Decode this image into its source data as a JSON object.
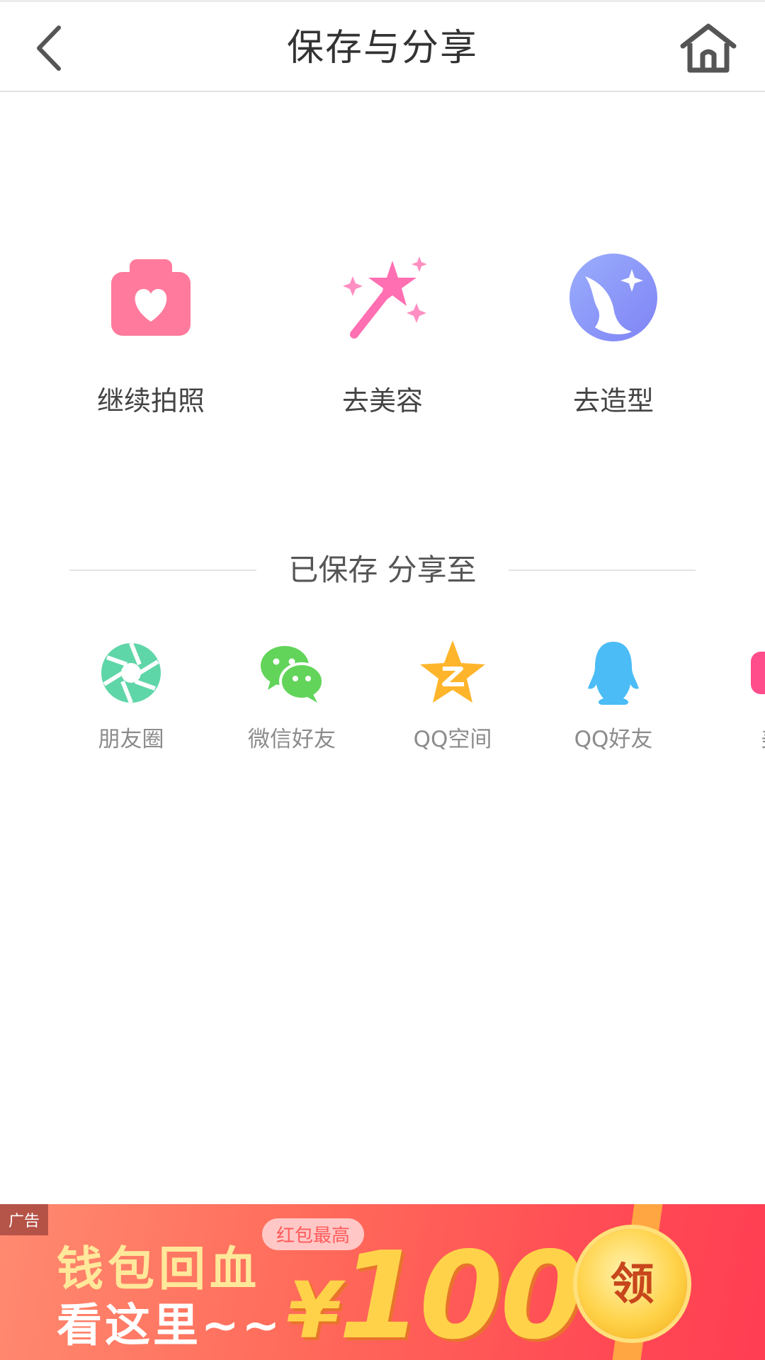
{
  "header": {
    "title": "保存与分享",
    "back_icon": "chevron-left-icon",
    "home_icon": "home-icon"
  },
  "actions": [
    {
      "label": "继续拍照",
      "icon": "camera-heart-icon",
      "color": "#ff7a9c"
    },
    {
      "label": "去美容",
      "icon": "magic-wand-icon",
      "color": "#ff6fb2"
    },
    {
      "label": "去造型",
      "icon": "face-sparkle-icon",
      "color": "#8b9dfb"
    }
  ],
  "share": {
    "heading": "已保存 分享至",
    "items": [
      {
        "label": "朋友圈",
        "icon": "moments-icon",
        "color": "#5fd6a8"
      },
      {
        "label": "微信好友",
        "icon": "wechat-icon",
        "color": "#62d45a"
      },
      {
        "label": "QQ空间",
        "icon": "qzone-icon",
        "color": "#ffb52b"
      },
      {
        "label": "QQ好友",
        "icon": "qq-icon",
        "color": "#4bbcf5"
      },
      {
        "label": "美",
        "icon": "meipai-icon",
        "color": "#ff4c8a"
      }
    ]
  },
  "ad": {
    "tag": "广告",
    "line1": "钱包回血",
    "line2": "看这里~~",
    "pill": "红包最高",
    "currency": "¥",
    "amount": "100",
    "button": "领"
  }
}
